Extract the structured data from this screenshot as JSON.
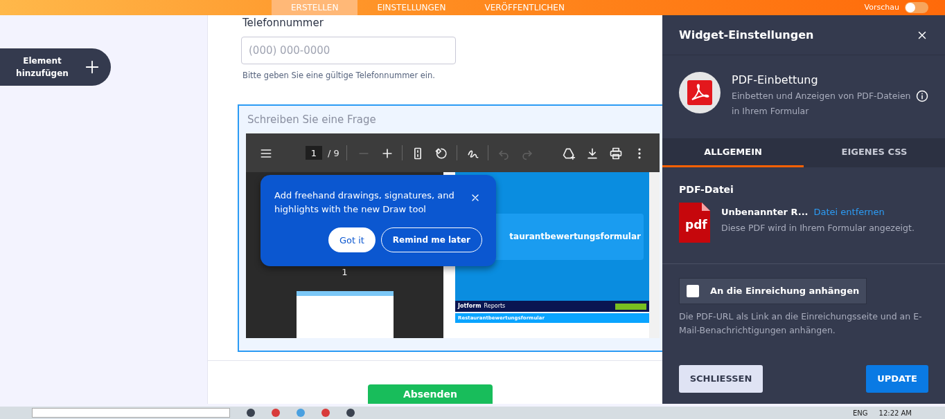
{
  "top_nav": {
    "tabs": [
      {
        "label": "ERSTELLEN",
        "selected": true
      },
      {
        "label": "EINSTELLUNGEN",
        "selected": false
      },
      {
        "label": "VERÖFFENTLICHEN",
        "selected": false
      }
    ],
    "preview": {
      "label": "Vorschau",
      "on": false
    }
  },
  "sidebar": {
    "add_button": "Element hinzufügen"
  },
  "form": {
    "phone": {
      "label": "Telefonnummer",
      "placeholder": "(000) 000-0000",
      "hint": "Bitte geben Sie eine gültige Telefonnummer ein."
    },
    "question": {
      "placeholder": "Schreiben Sie eine Frage",
      "selected": true,
      "pdf_viewer": {
        "page": "1",
        "page_total": "/ 9",
        "toolbar": [
          {
            "kind": "menu",
            "disabled": false
          },
          {
            "kind": "page"
          },
          {
            "kind": "zoom-out",
            "disabled": true
          },
          {
            "kind": "zoom-in",
            "disabled": false
          },
          {
            "kind": "fit",
            "disabled": false
          },
          {
            "kind": "rotate",
            "disabled": false
          },
          {
            "kind": "draw",
            "disabled": false
          },
          {
            "kind": "undo",
            "disabled": true
          },
          {
            "kind": "redo",
            "disabled": true
          },
          {
            "kind": "drive",
            "disabled": false
          },
          {
            "kind": "download",
            "disabled": false
          },
          {
            "kind": "print",
            "disabled": false
          },
          {
            "kind": "more",
            "disabled": false
          }
        ],
        "thumbnail_label": "1",
        "page_title": "taurantbewertungsformular",
        "report_brand": "Jotform",
        "report_section": "Reports",
        "report_form_title": "Restaurantbewertungsformular",
        "popup": {
          "text": "Add freehand drawings, signatures, and highlights with the new Draw tool",
          "buttons": [
            "Got it",
            "Remind me later"
          ]
        }
      }
    },
    "submit": "Absenden"
  },
  "panel": {
    "title": "Widget-Einstellungen",
    "widget": {
      "name": "PDF-Einbettung",
      "description": "Einbetten und Anzeigen von PDF-Dateien in Ihrem Formular"
    },
    "tabs": [
      {
        "label": "ALLGEMEIN",
        "selected": true
      },
      {
        "label": "EIGENES CSS",
        "selected": false
      }
    ],
    "section_title": "PDF-Datei",
    "file": {
      "icon_text": "pdf",
      "name": "Unbenannter R...",
      "remove_link": "Datei entfernen",
      "note": "Diese PDF wird in Ihrem Formular angezeigt."
    },
    "attach": {
      "label": "An die Einreichung anhängen",
      "checked": false
    },
    "attach_help": "Die PDF-URL als Link an die Einreichungsseite und an E-Mail-Benachrichtigungen anhängen.",
    "buttons": {
      "close": "SCHLIESSEN",
      "update": "UPDATE"
    }
  },
  "taskbar": {
    "language": "ENG",
    "time": "12:22 AM"
  }
}
